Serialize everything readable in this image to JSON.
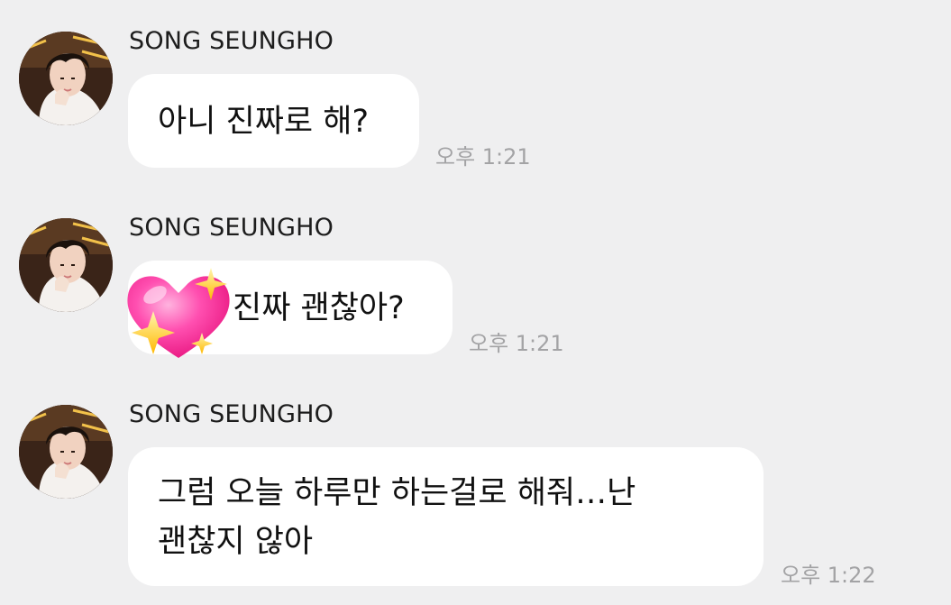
{
  "messages": [
    {
      "sender": "SONG SEUNGHO",
      "text": "아니 진짜로 해?",
      "time": "오후 1:21",
      "avatar_icon": "profile-photo"
    },
    {
      "sender": "SONG SEUNGHO",
      "text": "진짜 괜찮아?",
      "time": "오후 1:21",
      "avatar_icon": "profile-photo",
      "emoji_icon": "sparkling-heart-emoji"
    },
    {
      "sender": "SONG SEUNGHO",
      "text_line1": "그럼 오늘 하루만 하는걸로 해줘…난",
      "text_line2": "괜찮지 않아",
      "time": "오후 1:22",
      "avatar_icon": "profile-photo"
    }
  ],
  "colors": {
    "background": "#efeff0",
    "bubble": "#ffffff",
    "time": "#a3a3a5",
    "heart": "#ff3fa4",
    "sparkle": "#ffd23a"
  }
}
